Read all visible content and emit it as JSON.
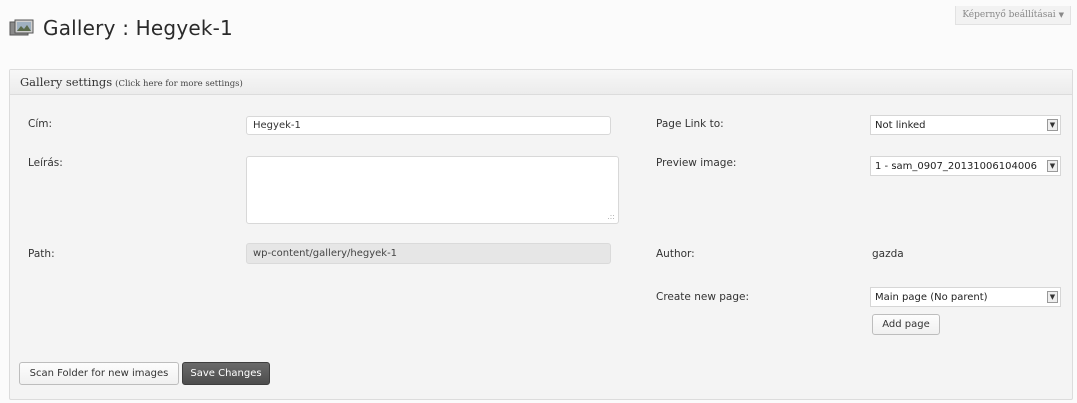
{
  "header": {
    "title": "Gallery : Hegyek-1",
    "screen_options": "Képernyő beállításai",
    "icon": "gallery-icon"
  },
  "panel": {
    "title": "Gallery settings",
    "hint": "(Click here for more settings)"
  },
  "fields": {
    "title_label": "Cím:",
    "title_value": "Hegyek-1",
    "description_label": "Leírás:",
    "description_value": "",
    "path_label": "Path:",
    "path_value": "wp-content/gallery/hegyek-1",
    "page_link_label": "Page Link to:",
    "page_link_value": "Not linked",
    "preview_label": "Preview image:",
    "preview_value": "1 - sam_0907_20131006104006",
    "author_label": "Author:",
    "author_value": "gazda",
    "create_page_label": "Create new page:",
    "create_page_value": "Main page (No parent)"
  },
  "buttons": {
    "add_page": "Add page",
    "scan_folder": "Scan Folder for new images",
    "save_changes": "Save Changes"
  }
}
